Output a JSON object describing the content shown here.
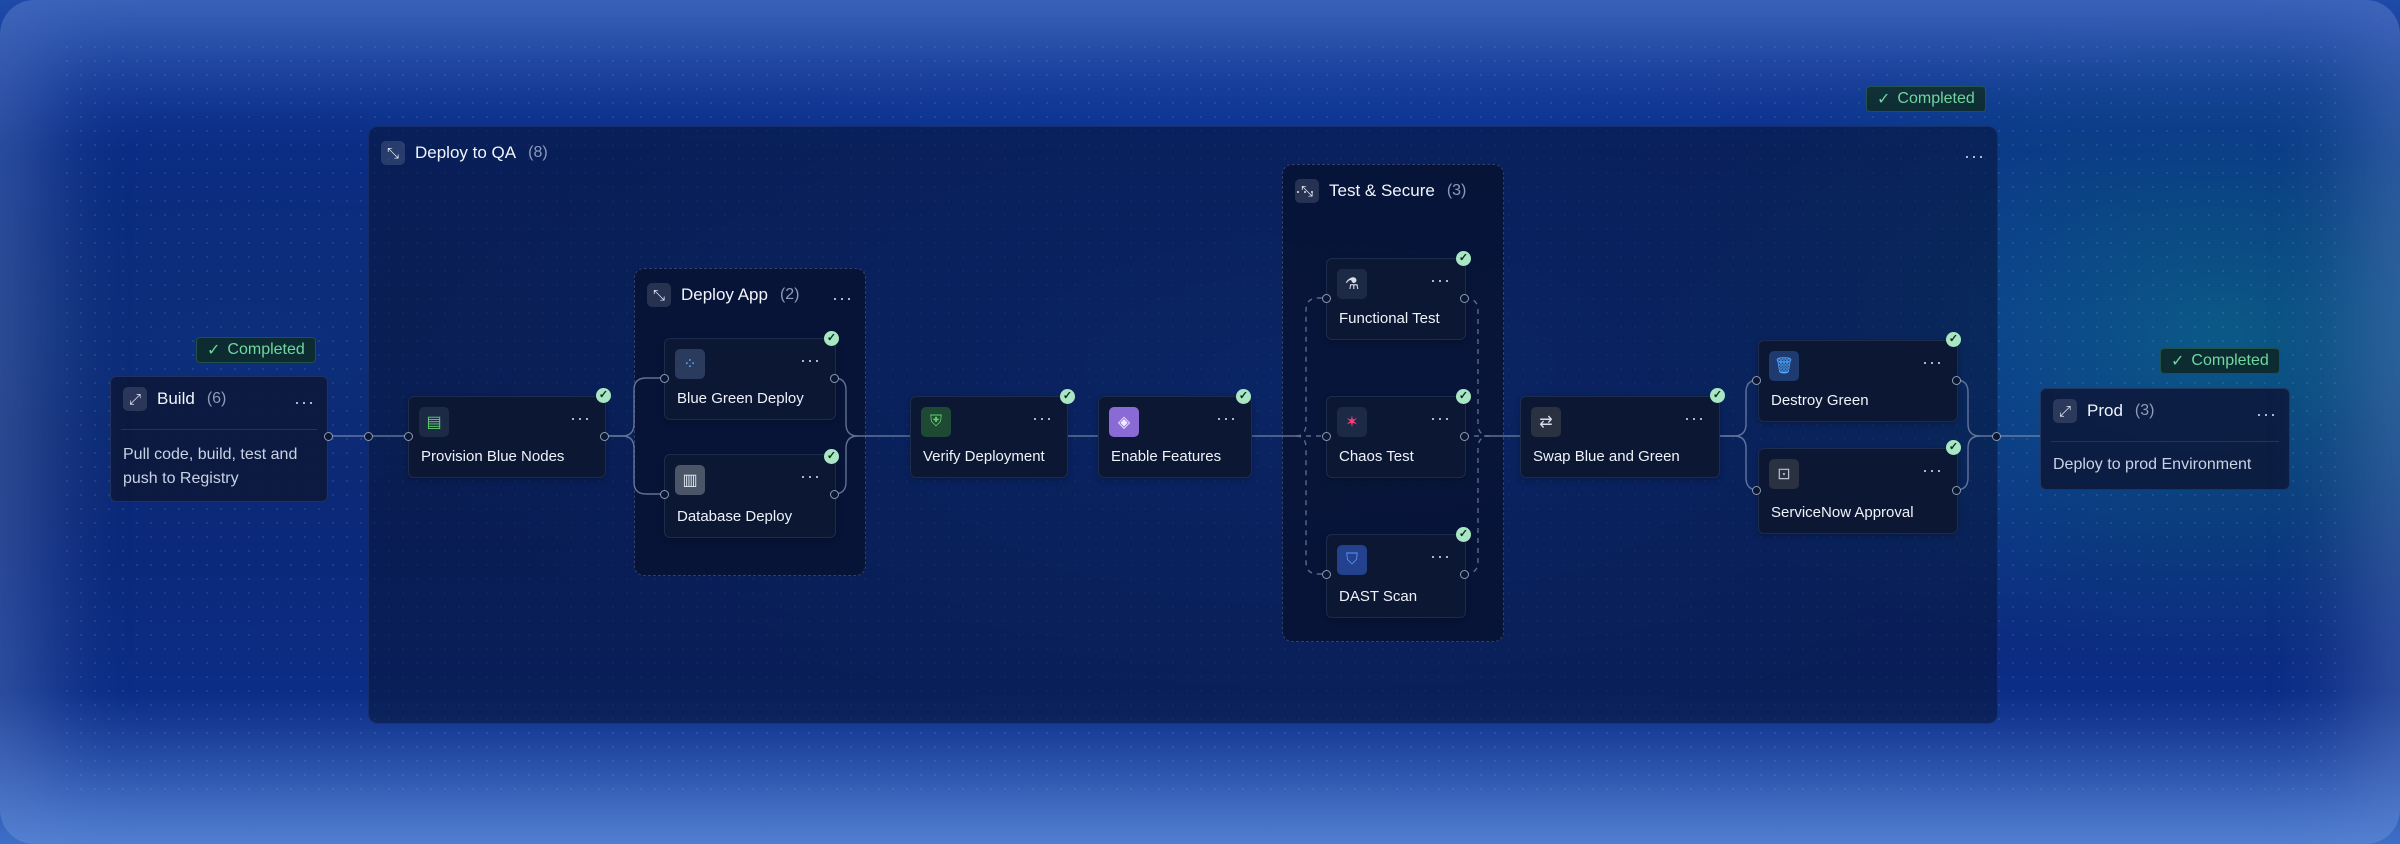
{
  "status_label": "Completed",
  "colors": {
    "accent_green": "#6fd89e",
    "node_bg": "#0c1733",
    "canvas_blue": "#0a2470"
  },
  "stages": {
    "build": {
      "title": "Build",
      "count": "(6)",
      "description_line1": "Pull code, build, test and",
      "description_line2": "push to Registry",
      "status": "Completed"
    },
    "qa": {
      "title": "Deploy to QA",
      "count": "(8)",
      "status": "Completed"
    },
    "prod": {
      "title": "Prod",
      "count": "(3)",
      "description": "Deploy to prod Environment",
      "status": "Completed"
    }
  },
  "groups": {
    "deploy_app": {
      "title": "Deploy App",
      "count": "(2)"
    },
    "test_secure": {
      "title": "Test & Secure",
      "count": "(3)"
    }
  },
  "steps": {
    "provision": {
      "label": "Provision Blue Nodes",
      "icon": "nodes-icon"
    },
    "blue_green": {
      "label": "Blue Green Deploy",
      "icon": "grid-icon"
    },
    "database": {
      "label": "Database Deploy",
      "icon": "database-icon"
    },
    "verify": {
      "label": "Verify Deployment",
      "icon": "shield-check-icon"
    },
    "features": {
      "label": "Enable Features",
      "icon": "feature-flag-icon"
    },
    "functional": {
      "label": "Functional Test",
      "icon": "flask-icon"
    },
    "chaos": {
      "label": "Chaos Test",
      "icon": "chaos-icon"
    },
    "dast": {
      "label": "DAST Scan",
      "icon": "security-scan-icon"
    },
    "swap": {
      "label": "Swap Blue and Green",
      "icon": "swap-icon"
    },
    "destroy": {
      "label": "Destroy Green",
      "icon": "trash-icon"
    },
    "servicenow": {
      "label": "ServiceNow Approval",
      "icon": "approval-icon"
    }
  }
}
